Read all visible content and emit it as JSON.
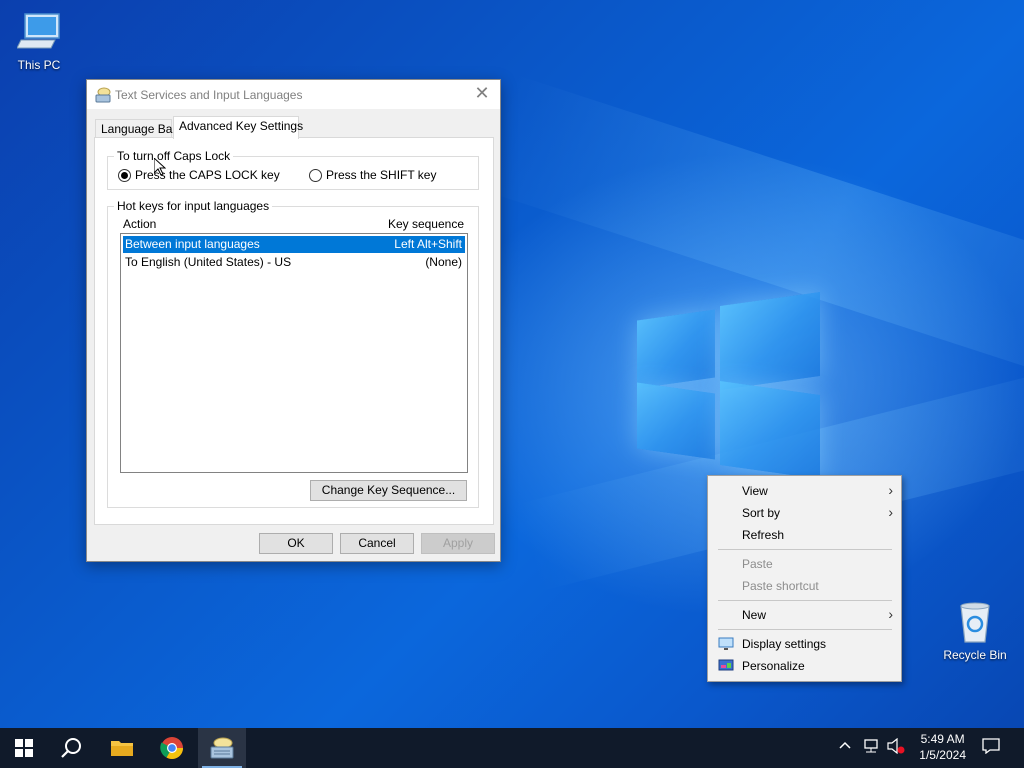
{
  "desktop": {
    "icons": [
      {
        "label": "This PC"
      },
      {
        "label": "Recycle Bin"
      }
    ]
  },
  "dialog": {
    "title": "Text Services and Input Languages",
    "close_glyph": "✕",
    "tabs": [
      {
        "label": "Language Bar"
      },
      {
        "label": "Advanced Key Settings"
      }
    ],
    "caps_group": {
      "legend": "To turn off Caps Lock",
      "options": [
        {
          "label": "Press the CAPS LOCK key",
          "selected": true
        },
        {
          "label": "Press the SHIFT key",
          "selected": false
        }
      ]
    },
    "hotkeys_group": {
      "legend": "Hot keys for input languages",
      "columns": [
        "Action",
        "Key sequence"
      ],
      "rows": [
        {
          "action": "Between input languages",
          "keys": "Left Alt+Shift",
          "selected": true
        },
        {
          "action": "To English (United States) - US",
          "keys": "(None)",
          "selected": false
        }
      ],
      "change_button": "Change Key Sequence..."
    },
    "buttons": {
      "ok": "OK",
      "cancel": "Cancel",
      "apply": "Apply"
    }
  },
  "context_menu": {
    "items": [
      {
        "label": "View",
        "submenu": true,
        "enabled": true
      },
      {
        "label": "Sort by",
        "submenu": true,
        "enabled": true
      },
      {
        "label": "Refresh",
        "enabled": true
      },
      {
        "label": "Paste",
        "enabled": false
      },
      {
        "label": "Paste shortcut",
        "enabled": false
      },
      {
        "label": "New",
        "submenu": true,
        "enabled": true
      },
      {
        "label": "Display settings",
        "icon": "display-icon",
        "enabled": true
      },
      {
        "label": "Personalize",
        "icon": "personalize-icon",
        "enabled": true
      }
    ],
    "submenu_glyph": "›"
  },
  "taskbar": {
    "apps": [
      "start-icon",
      "search-icon",
      "file-explorer-icon",
      "chrome-icon",
      "text-services-icon"
    ],
    "tray": {
      "time": "5:49 AM",
      "date": "1/5/2024"
    }
  },
  "colors": {
    "accent": "#0078d7",
    "taskbar": "#101a2a"
  }
}
